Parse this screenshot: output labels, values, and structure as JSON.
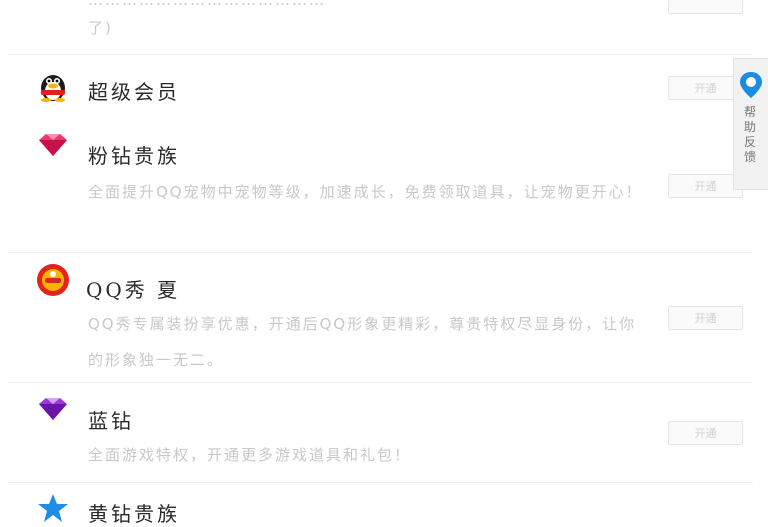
{
  "top_item": {
    "desc_line1": "……………………………………",
    "desc_line2": "了)"
  },
  "items": [
    {
      "title": "超级会员",
      "icon": "qq-penguin-icon",
      "desc": "",
      "button": "开通"
    },
    {
      "title": "粉钻贵族",
      "icon": "pink-diamond-icon",
      "desc": "全面提升QQ宠物中宠物等级，加速成长，免费领取道具，让宠物更开心！",
      "button": "开通"
    },
    {
      "title": "QQ秀 夏",
      "icon": "qq-show-icon",
      "desc": "QQ秀专属装扮享优惠，开通后QQ形象更精彩，尊贵特权尽显身份，让你的形象独一无二。",
      "button": "开通"
    },
    {
      "title": "蓝钻",
      "icon": "purple-diamond-icon",
      "desc": "全面游戏特权，开通更多游戏道具和礼包！",
      "button": "开通"
    },
    {
      "title": "黄钻贵族",
      "icon": "blue-star-icon"
    }
  ],
  "side_tab": {
    "label": "帮助反馈"
  },
  "colors": {
    "divider": "#eeeeee",
    "desc_text": "#c8c8c8",
    "title_text": "#2b2b2b"
  }
}
